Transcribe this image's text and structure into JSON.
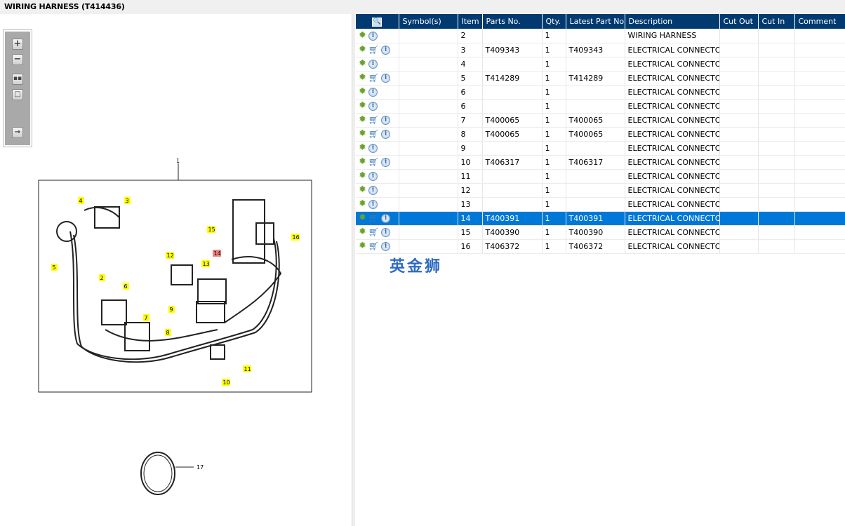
{
  "title": "WIRING HARNESS (T414436)",
  "toolbar": {
    "icons": [
      "zoom-in-icon",
      "zoom-out-icon",
      "fit-all-icon",
      "fit-window-icon",
      "export-icon"
    ]
  },
  "diagram": {
    "main_label": "1",
    "callouts": [
      "4",
      "3",
      "5",
      "2",
      "6",
      "7",
      "8",
      "12",
      "14",
      "13",
      "15",
      "16",
      "9",
      "11",
      "10"
    ],
    "highlighted": "14",
    "clip_label": "17"
  },
  "grid": {
    "headers": [
      "",
      "Symbol(s)",
      "Item",
      "Parts No.",
      "Qty.",
      "Latest Part No.",
      "Description",
      "Cut Out",
      "Cut In",
      "Comment"
    ],
    "rows": [
      {
        "item": "2",
        "parts": "",
        "qty": "1",
        "latest": "",
        "desc": "WIRING HARNESS",
        "cart": false
      },
      {
        "item": "3",
        "parts": "T409343",
        "qty": "1",
        "latest": "T409343",
        "desc": "ELECTRICAL CONNECTOR",
        "cart": true
      },
      {
        "item": "4",
        "parts": "",
        "qty": "1",
        "latest": "",
        "desc": "ELECTRICAL CONNECTOR",
        "cart": false
      },
      {
        "item": "5",
        "parts": "T414289",
        "qty": "1",
        "latest": "T414289",
        "desc": "ELECTRICAL CONNECTOR",
        "cart": true
      },
      {
        "item": "6",
        "parts": "",
        "qty": "1",
        "latest": "",
        "desc": "ELECTRICAL CONNECTOR",
        "cart": false
      },
      {
        "item": "6",
        "parts": "",
        "qty": "1",
        "latest": "",
        "desc": "ELECTRICAL CONNECTOR",
        "cart": false
      },
      {
        "item": "7",
        "parts": "T400065",
        "qty": "1",
        "latest": "T400065",
        "desc": "ELECTRICAL CONNECTOR",
        "cart": true
      },
      {
        "item": "8",
        "parts": "T400065",
        "qty": "1",
        "latest": "T400065",
        "desc": "ELECTRICAL CONNECTOR",
        "cart": true
      },
      {
        "item": "9",
        "parts": "",
        "qty": "1",
        "latest": "",
        "desc": "ELECTRICAL CONNECTOR",
        "cart": false
      },
      {
        "item": "10",
        "parts": "T406317",
        "qty": "1",
        "latest": "T406317",
        "desc": "ELECTRICAL CONNECTOR",
        "cart": true
      },
      {
        "item": "11",
        "parts": "",
        "qty": "1",
        "latest": "",
        "desc": "ELECTRICAL CONNECTOR",
        "cart": false
      },
      {
        "item": "12",
        "parts": "",
        "qty": "1",
        "latest": "",
        "desc": "ELECTRICAL CONNECTOR",
        "cart": false
      },
      {
        "item": "13",
        "parts": "",
        "qty": "1",
        "latest": "",
        "desc": "ELECTRICAL CONNECTOR",
        "cart": false
      },
      {
        "item": "14",
        "parts": "T400391",
        "qty": "1",
        "latest": "T400391",
        "desc": "ELECTRICAL CONNECTOR",
        "cart": true,
        "selected": true
      },
      {
        "item": "15",
        "parts": "T400390",
        "qty": "1",
        "latest": "T400390",
        "desc": "ELECTRICAL CONNECTOR",
        "cart": true
      },
      {
        "item": "16",
        "parts": "T406372",
        "qty": "1",
        "latest": "T406372",
        "desc": "ELECTRICAL CONNECTOR",
        "cart": true
      }
    ]
  },
  "watermark": "英金狮",
  "colors": {
    "header": "#003a70",
    "selected": "#0078d7",
    "callout": "#ffff00",
    "callout_highlight": "#f08080"
  }
}
